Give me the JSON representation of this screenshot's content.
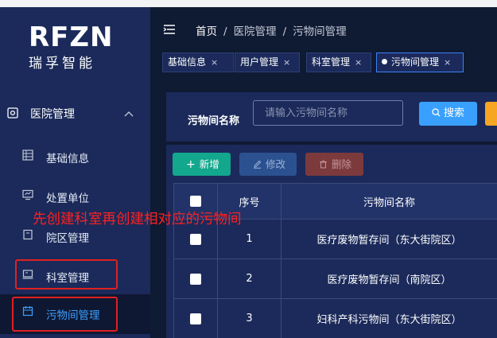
{
  "sidebar": {
    "logo_main": "RFZN",
    "logo_sub": "瑞孚智能",
    "group": {
      "label": "医院管理",
      "icon": "hospital-icon",
      "expanded": true
    },
    "items": [
      {
        "label": "基础信息",
        "icon": "grid-icon"
      },
      {
        "label": "处置单位",
        "icon": "monitor-icon"
      },
      {
        "label": "院区管理",
        "icon": "building-icon"
      },
      {
        "label": "科室管理",
        "icon": "laptop-icon"
      },
      {
        "label": "污物间管理",
        "icon": "calendar-icon",
        "active": true
      }
    ]
  },
  "breadcrumb": {
    "home": "首页",
    "parent": "医院管理",
    "current": "污物间管理"
  },
  "tabs": [
    {
      "label": "基础信息",
      "active": false
    },
    {
      "label": "用户管理",
      "active": false
    },
    {
      "label": "科室管理",
      "active": false
    },
    {
      "label": "污物间管理",
      "active": true
    }
  ],
  "tab_close": "×",
  "search": {
    "label": "污物间名称",
    "placeholder": "请输入污物间名称",
    "button": "搜索"
  },
  "toolbar": {
    "add": "新增",
    "edit": "修改",
    "delete": "删除"
  },
  "table": {
    "columns": [
      "",
      "序号",
      "污物间名称"
    ],
    "rows": [
      {
        "index": "1",
        "name": "医疗废物暂存间（东大街院区）"
      },
      {
        "index": "2",
        "name": "医疗废物暂存间（南院区）"
      },
      {
        "index": "3",
        "name": "妇科产科污物间（东大街院区）"
      }
    ]
  },
  "annotation": "先创建科室再创建相对应的污物间",
  "colors": {
    "sidebar": "#1b2a5a",
    "background": "#0f1a33",
    "accent": "#3aa0ff",
    "add": "#13a78d",
    "annotation": "#ff2020"
  }
}
